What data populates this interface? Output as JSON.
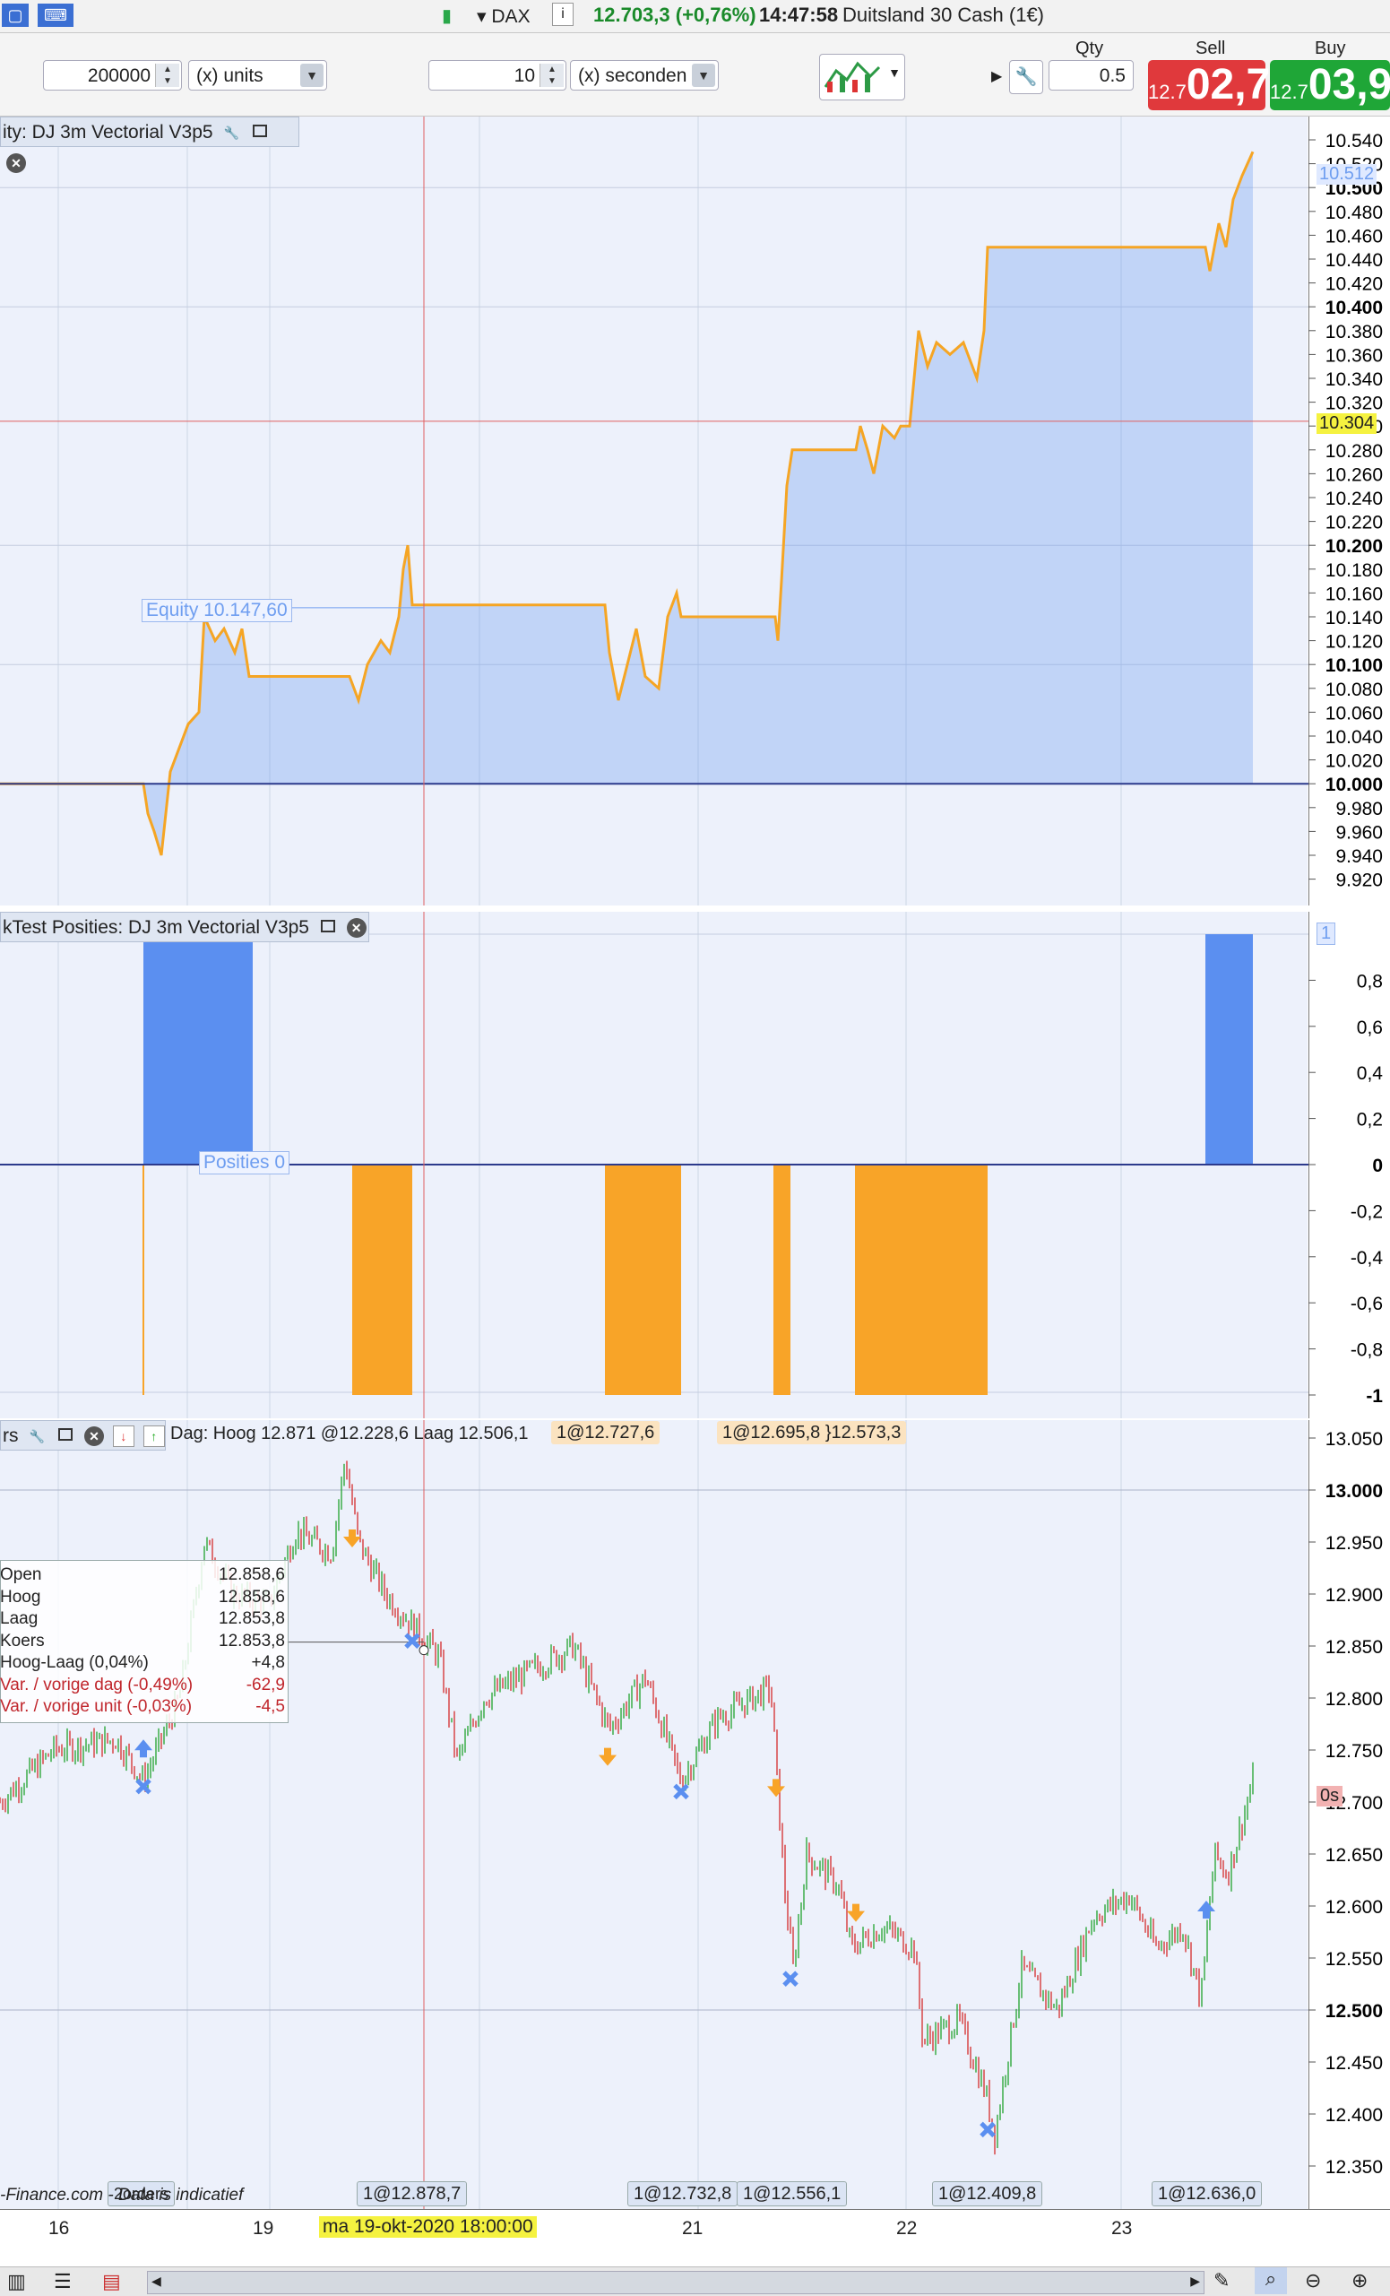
{
  "topbar": {
    "instrument": "DAX",
    "price": "12.703,3 (+0,76%)",
    "time": "14:47:58",
    "name": "Duitsland 30 Cash (1€)"
  },
  "toolbar": {
    "units_value": "200000",
    "units_label": "(x) units",
    "seconds_value": "10",
    "seconds_label": "(x) seconden",
    "qty_label": "Qty",
    "qty_value": "0.5",
    "sell_label": "Sell",
    "buy_label": "Buy",
    "sell_small": "12.7",
    "sell_big": "02,7",
    "buy_small": "12.7",
    "buy_big": "03,9",
    "sell_color": "#e0393c",
    "buy_color": "#1fa637"
  },
  "equity_panel": {
    "title": "ity: DJ 3m Vectorial V3p5",
    "equity_label": "Equity 10.147,60",
    "current_value": "10.512",
    "crosshair_value": "10.304",
    "ticks": [
      "10.540",
      "10.520",
      "10.500",
      "10.480",
      "10.460",
      "10.440",
      "10.420",
      "10.400",
      "10.380",
      "10.360",
      "10.340",
      "10.320",
      "10.300",
      "10.280",
      "10.260",
      "10.240",
      "10.220",
      "10.200",
      "10.180",
      "10.160",
      "10.140",
      "10.120",
      "10.100",
      "10.080",
      "10.060",
      "10.040",
      "10.020",
      "10.000",
      "9.980",
      "9.960",
      "9.940",
      "9.920"
    ],
    "line_color": "#f5a524",
    "area_color": "#6f9ef0"
  },
  "positions_panel": {
    "title": "kTest Posities: DJ 3m Vectorial V3p5",
    "positions_label": "Posities 0",
    "current_value": "1",
    "ticks": [
      "0,8",
      "0,6",
      "0,4",
      "0,2",
      "0",
      "-0,2",
      "-0,4",
      "-0,6",
      "-0,8",
      "-1"
    ],
    "long_color": "#5b8ff0",
    "short_color": "#f8a428"
  },
  "price_panel": {
    "title": "rs",
    "info_text": "Dag: Hoog 12.871 @12.228,6  Laag 12.506,1",
    "top_tags": [
      "1@12.727,6",
      "1@12.695,8 }12.573,3"
    ],
    "bottom_tags": [
      "1@12.878,7",
      "1@12.732,8",
      "1@12.556,1",
      "1@12.409,8",
      "1@12.636,0"
    ],
    "orders_tag": "2orders",
    "source_text": "-Finance.com - Data is indicatief",
    "current_value": "0s",
    "ticks": [
      "13.050",
      "13.000",
      "12.950",
      "12.900",
      "12.850",
      "12.800",
      "12.750",
      "12.700",
      "12.650",
      "12.600",
      "12.550",
      "12.500",
      "12.450",
      "12.400",
      "12.350"
    ],
    "info_box": [
      {
        "label": "Open",
        "value": "12.858,6"
      },
      {
        "label": "Hoog",
        "value": "12.858,6"
      },
      {
        "label": "Laag",
        "value": "12.853,8"
      },
      {
        "label": "Koers",
        "value": "12.853,8"
      },
      {
        "label": "Hoog-Laag (0,04%)",
        "value": "+4,8"
      },
      {
        "label": "Var. / vorige dag (-0,49%)",
        "value": "-62,9"
      },
      {
        "label": "Var. / vorige unit (-0,03%)",
        "value": "-4,5"
      }
    ]
  },
  "x_axis": {
    "labels": [
      "16",
      "19",
      "21",
      "22",
      "23"
    ],
    "crosshair_date": "ma 19-okt-2020 18:00:00"
  }
}
